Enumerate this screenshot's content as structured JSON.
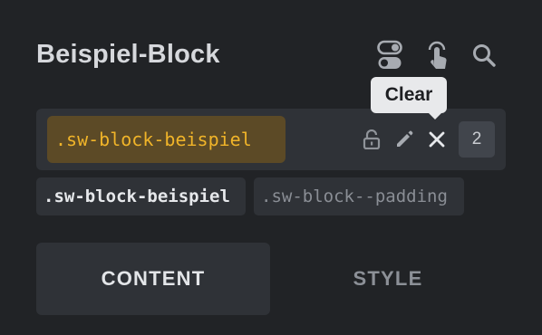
{
  "panel": {
    "title": "Beispiel-Block"
  },
  "header_icons": [
    "toggle-icon",
    "touch-icon",
    "search-icon"
  ],
  "tooltip": {
    "text": "Clear"
  },
  "selector": {
    "value": ".sw-block-beispiel",
    "icons": [
      "unlock-icon",
      "edit-icon",
      "close-icon"
    ],
    "count": "2"
  },
  "classes": [
    {
      "label": ".sw-block-beispiel",
      "active": true
    },
    {
      "label": ".sw-block--padding",
      "active": false
    }
  ],
  "tabs": [
    {
      "label": "CONTENT",
      "active": true
    },
    {
      "label": "STYLE",
      "active": false
    }
  ],
  "colors": {
    "background": "#212326",
    "surface": "#2f3237",
    "selector_bg": "#5c4a26",
    "selector_text": "#f0b429",
    "tooltip_bg": "#e8e9eb"
  }
}
